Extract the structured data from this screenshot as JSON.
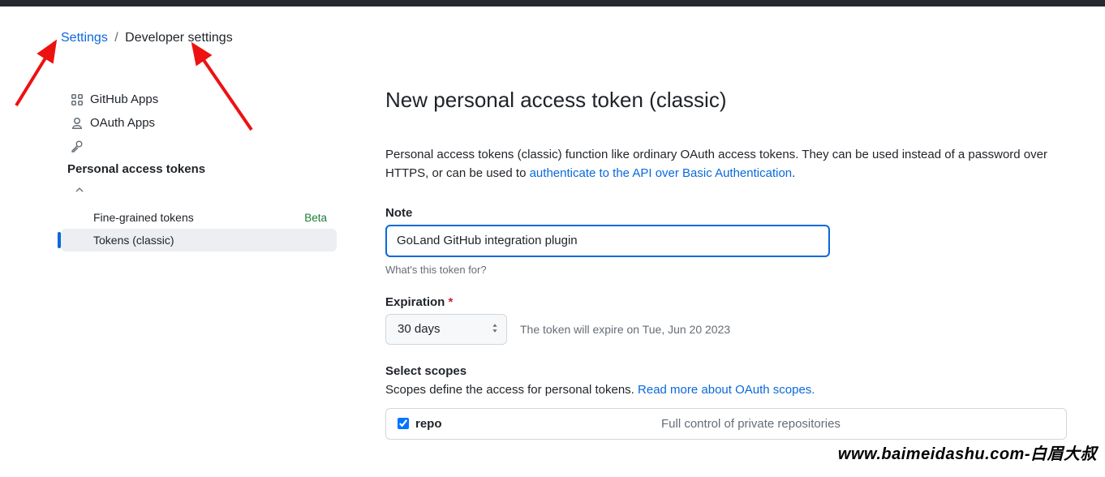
{
  "breadcrumb": {
    "parent": "Settings",
    "current": "Developer settings"
  },
  "sidebar": {
    "github_apps": "GitHub Apps",
    "oauth_apps": "OAuth Apps",
    "pat_header": "Personal access tokens",
    "fine_grained": "Fine-grained tokens",
    "fine_grained_badge": "Beta",
    "tokens_classic": "Tokens (classic)"
  },
  "main": {
    "title": "New personal access token (classic)",
    "desc_part1": "Personal access tokens (classic) function like ordinary OAuth access tokens. They can be used instead of a password over HTTPS, or can be used to ",
    "desc_link": "authenticate to the API over Basic Authentication",
    "desc_part2": ".",
    "note_label": "Note",
    "note_value": "GoLand GitHub integration plugin",
    "note_help": "What's this token for?",
    "expiration_label": "Expiration",
    "expiration_value": "30 days",
    "expiration_hint": "The token will expire on Tue, Jun 20 2023",
    "scopes_label": "Select scopes",
    "scopes_desc": "Scopes define the access for personal tokens. ",
    "scopes_link": "Read more about OAuth scopes.",
    "scope_repo_name": "repo",
    "scope_repo_desc": "Full control of private repositories"
  },
  "watermark": "www.baimeidashu.com-白眉大叔"
}
